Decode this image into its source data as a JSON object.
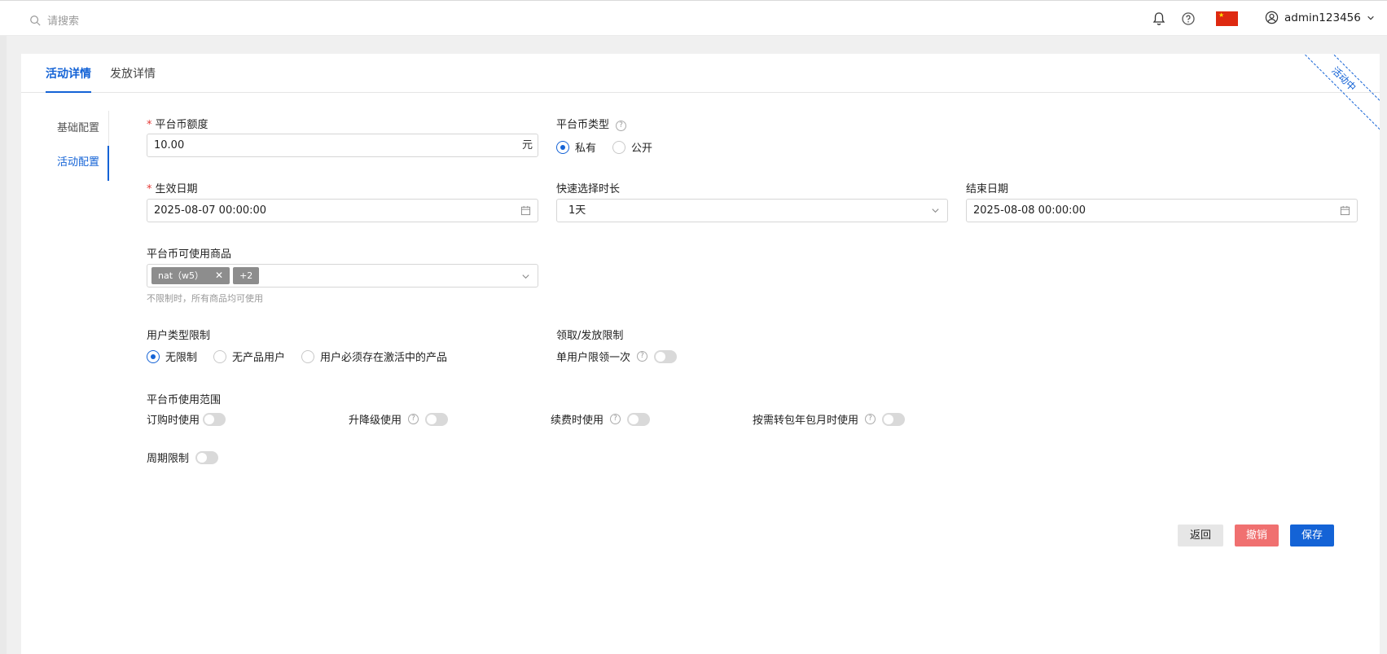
{
  "topbar": {
    "search_placeholder": "请搜索",
    "username": "admin123456"
  },
  "tabs": [
    {
      "label": "活动详情",
      "active": true
    },
    {
      "label": "发放详情",
      "active": false
    }
  ],
  "status_ribbon": "活动中",
  "sidenav": [
    {
      "label": "基础配置",
      "active": false
    },
    {
      "label": "活动配置",
      "active": true
    }
  ],
  "form": {
    "amount": {
      "label": "平台币额度",
      "value": "10.00",
      "suffix": "元"
    },
    "coin_type": {
      "label": "平台币类型",
      "options": [
        "私有",
        "公开"
      ],
      "selected": "私有"
    },
    "start_date": {
      "label": "生效日期",
      "value": "2025-08-07 00:00:00"
    },
    "duration": {
      "label": "快速选择时长",
      "value": "1天"
    },
    "end_date": {
      "label": "结束日期",
      "value": "2025-08-08 00:00:00"
    },
    "products": {
      "label": "平台币可使用商品",
      "tags": [
        "nat（w5）",
        "+2"
      ],
      "hint": "不限制时，所有商品均可使用"
    },
    "user_type": {
      "label": "用户类型限制",
      "options": [
        "无限制",
        "无产品用户",
        "用户必须存在激活中的产品"
      ],
      "selected": "无限制"
    },
    "claim_limit": {
      "label": "领取/发放限制",
      "single_user_once": "单用户限领一次"
    },
    "usage_scope": {
      "label": "平台币使用范围",
      "items": [
        "订购时使用",
        "升降级使用",
        "续费时使用",
        "按需转包年包月时使用"
      ]
    },
    "period_limit": "周期限制"
  },
  "buttons": {
    "back": "返回",
    "revoke": "撤销",
    "save": "保存"
  },
  "colors": {
    "primary": "#1463d6",
    "danger": "#f07070",
    "required": "#e53935"
  }
}
